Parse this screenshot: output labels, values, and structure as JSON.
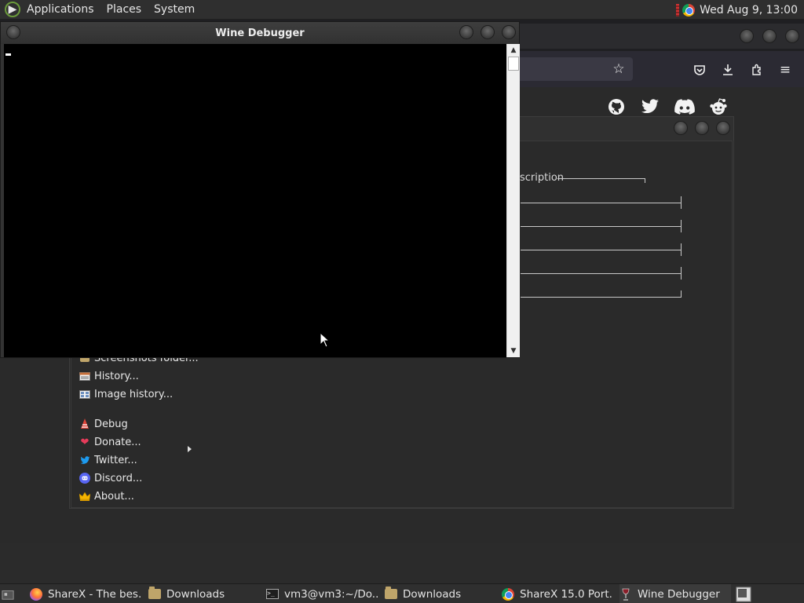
{
  "top_panel": {
    "menus": [
      "Applications",
      "Places",
      "System"
    ],
    "clock": "Wed Aug  9, 13:00"
  },
  "background_browser": {
    "social_icons": [
      "github-icon",
      "twitter-icon",
      "discord-icon",
      "reddit-icon"
    ]
  },
  "sharex_window": {
    "column_fragment": "scription",
    "menu": [
      {
        "label": "Screenshots folder...",
        "icon": "folder-icon"
      },
      {
        "label": "History...",
        "icon": "history-icon"
      },
      {
        "label": "Image history...",
        "icon": "image-history-icon"
      },
      {
        "label": "Debug",
        "icon": "debug-icon",
        "submenu": true
      },
      {
        "label": "Donate...",
        "icon": "heart-icon"
      },
      {
        "label": "Twitter...",
        "icon": "twitter-icon"
      },
      {
        "label": "Discord...",
        "icon": "discord-icon"
      },
      {
        "label": "About...",
        "icon": "crown-icon"
      }
    ]
  },
  "wine_debugger": {
    "title": "Wine Debugger"
  },
  "taskbar": {
    "tasks": [
      {
        "label": "ShareX - The bes...",
        "icon": "firefox-icon"
      },
      {
        "label": "Downloads",
        "icon": "folder-icon"
      },
      {
        "label": "vm3@vm3:~/Do...",
        "icon": "terminal-icon"
      },
      {
        "label": "Downloads",
        "icon": "folder-icon"
      },
      {
        "label": "ShareX 15.0 Port...",
        "icon": "chrome-icon"
      },
      {
        "label": "Wine Debugger",
        "icon": "wine-icon"
      }
    ]
  },
  "colors": {
    "panel": "#2f2f2f",
    "console": "#000000",
    "menu_text": "#e8e8e8"
  }
}
